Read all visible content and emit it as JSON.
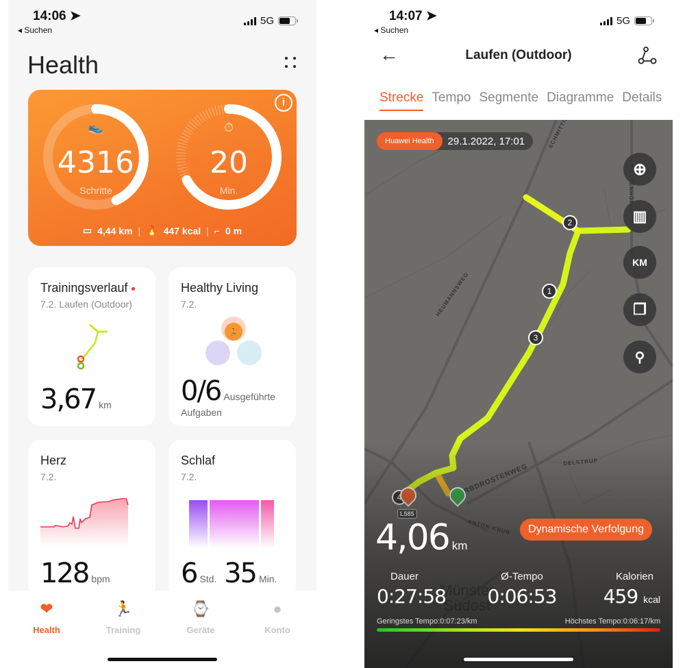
{
  "left": {
    "status": {
      "time": "14:06",
      "back_label": "Suchen",
      "network": "5G"
    },
    "title": "Health",
    "activity_card": {
      "steps": {
        "value": "4316",
        "label": "Schritte",
        "progress": 0.43
      },
      "minutes": {
        "value": "20",
        "label": "Min.",
        "progress": 0.67
      },
      "distance": "4,44 km",
      "calories": "447 kcal",
      "floors": "0 m"
    },
    "tiles": {
      "training": {
        "title": "Trainingsverlauf",
        "subtitle": "7.2. Laufen (Outdoor)",
        "value": "3,67",
        "unit": "km"
      },
      "healthy_living": {
        "title": "Healthy Living",
        "subtitle": "7.2.",
        "value": "0/6",
        "unit": "Ausgeführte",
        "unit2": "Aufgaben"
      },
      "heart": {
        "title": "Herz",
        "subtitle": "7.2.",
        "value": "128",
        "unit": "bpm"
      },
      "sleep": {
        "title": "Schlaf",
        "subtitle": "7.2.",
        "hours": "6",
        "hours_unit": "Std.",
        "minutes": "35",
        "minutes_unit": "Min."
      }
    },
    "tabbar": [
      {
        "label": "Health",
        "icon": "heart-pulse-icon",
        "active": true
      },
      {
        "label": "Training",
        "icon": "runner-icon",
        "active": false
      },
      {
        "label": "Geräte",
        "icon": "watch-icon",
        "active": false
      },
      {
        "label": "Konto",
        "icon": "account-icon",
        "active": false
      }
    ]
  },
  "right": {
    "status": {
      "time": "14:07",
      "back_label": "Suchen",
      "network": "5G"
    },
    "nav_title": "Laufen (Outdoor)",
    "tabs": [
      "Strecke",
      "Tempo",
      "Segmente",
      "Diagramme",
      "Details"
    ],
    "active_tab": "Strecke",
    "map": {
      "source_badge": "Huawei Health",
      "datetime": "29.1.2022, 17:01",
      "buttons": [
        "locate-icon",
        "map-type-icon",
        "KM",
        "layers-icon",
        "route-pin-icon"
      ],
      "km_markers": [
        "1",
        "2",
        "3",
        "4"
      ],
      "streets": [
        "SCHMITTING",
        "HEUMANNSWEG",
        "ERBDROSTENWEG",
        "DELSTRUP",
        "ANTON-KNUB",
        "KOTTENHOF"
      ],
      "road_sign": "L585",
      "district": [
        "Münster",
        "Südost"
      ]
    },
    "distance": {
      "value": "4,06",
      "unit": "km"
    },
    "dynamic_button": "Dynamische Verfolgung",
    "metrics": [
      {
        "label": "Dauer",
        "value": "0:27:58",
        "unit": ""
      },
      {
        "label": "Ø-Tempo",
        "value": "0:06:53",
        "unit": ""
      },
      {
        "label": "Kalorien",
        "value": "459",
        "unit": "kcal"
      }
    ],
    "pace_min": "Geringstes Tempo:0:07:23/km",
    "pace_max": "Höchstes Tempo:0:06:17/km"
  },
  "colors": {
    "accent": "#f0602a",
    "route": "#d4f51c",
    "map_bg": "#6e6c69"
  }
}
